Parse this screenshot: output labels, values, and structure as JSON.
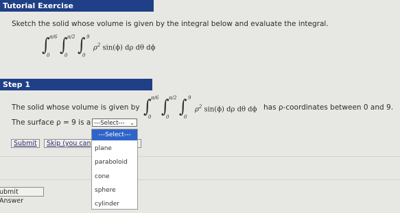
{
  "header": {
    "title": "Tutorial Exercise"
  },
  "exercise": {
    "prompt": "Sketch the solid whose volume is given by the integral below and evaluate the integral.",
    "integral": {
      "upper1": "π/6",
      "lower1": "0",
      "upper2": "π/2",
      "lower2": "0",
      "upper3": "9",
      "lower3": "0",
      "integrand": "ρ",
      "power": "2",
      "rest": " sin(ϕ) dρ dθ dϕ"
    }
  },
  "step": {
    "title": "Step 1",
    "sentence_before": "The solid whose volume is given by",
    "sentence_after": "has ρ-coordinates between 0 and 9.",
    "surface_text": "The surface ρ = 9 is a",
    "select_value": "---Select---",
    "dropdown_options": [
      "---Select---",
      "plane",
      "paraboloid",
      "cone",
      "sphere",
      "cylinder"
    ]
  },
  "buttons": {
    "submit": "Submit",
    "skip": "Skip (you can",
    "submit_answer": "ubmit Answer"
  },
  "colors": {
    "banner": "#1f3f86",
    "selected_option": "#2f64c8"
  }
}
